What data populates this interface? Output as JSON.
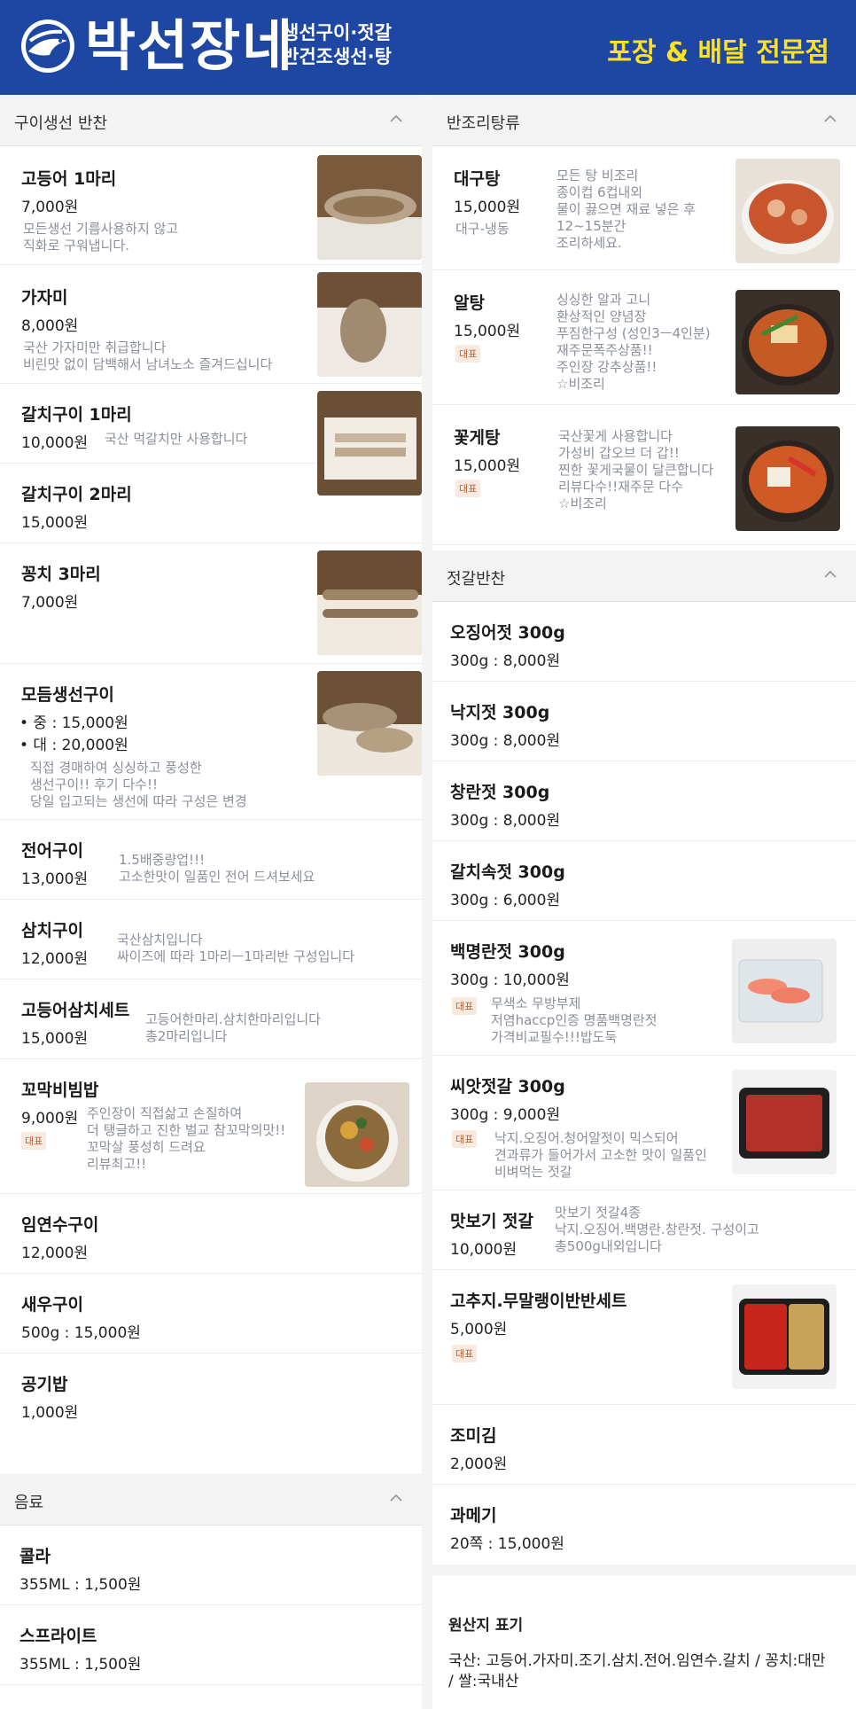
{
  "header": {
    "brand": "박선장네",
    "sub1": "생선구이·젓갈",
    "sub2": "반건조생선·탕",
    "slogan": "포장 & 배달 전문점"
  },
  "badge_label": "대표",
  "left": {
    "grilled": {
      "title": "구이생선 반찬",
      "items": [
        {
          "name": "고등어 1마리",
          "price": "7,000원",
          "desc1": "모든생선 기름사용하지  않고",
          "desc2": "직화로 구워냅니다."
        },
        {
          "name": "가자미",
          "price": "8,000원",
          "desc1": "국산  가자미만 취급합니다",
          "desc2": "비린맛 없이 담백해서 남녀노소 즐겨드십니다"
        },
        {
          "name": "갈치구이 1마리",
          "price": "10,000원",
          "desc1": "국산 먹갈치만  사용합니다"
        },
        {
          "name": "갈치구이 2마리",
          "price": "15,000원"
        },
        {
          "name": "꽁치 3마리",
          "price": "7,000원"
        },
        {
          "name": "모듬생선구이",
          "price1": "• 중 : 15,000원",
          "price2": "• 대 : 20,000원",
          "desc1": "직접 경매하여 싱싱하고 풍성한",
          "desc2": "생선구이!! 후기 다수!!",
          "desc3": "당일 입고되는 생선에 따라 구성은 변경"
        },
        {
          "name": "전어구이",
          "price": "13,000원",
          "desc1": "1.5배중량업!!!",
          "desc2": "고소한맛이 일품인 전어 드셔보세요"
        },
        {
          "name": "삼치구이",
          "price": "12,000원",
          "desc1": "국산삼치입니다",
          "desc2": "싸이즈에  따라 1마리ㅡ1마리반 구성입니다"
        },
        {
          "name": "고등어삼치세트",
          "price": "15,000원",
          "desc1": "고등어한마리.삼치한마리입니다",
          "desc2": "총2마리입니다"
        },
        {
          "name": "꼬막비빔밥",
          "price": "9,000원",
          "desc1": "주인장이 직접삶고  손질하여",
          "desc2": "더 탱글하고 진한 벌교 참꼬막의맛!!",
          "desc3": "꼬막살 풍성히 드려요",
          "desc4": "리뷰최고!!"
        },
        {
          "name": "임연수구이",
          "price": "12,000원"
        },
        {
          "name": "새우구이",
          "price": "500g : 15,000원"
        },
        {
          "name": "공기밥",
          "price": "1,000원"
        }
      ]
    },
    "drinks": {
      "title": "음료",
      "items": [
        {
          "name": "콜라",
          "price": "355ML : 1,500원"
        },
        {
          "name": "스프라이트",
          "price": "355ML : 1,500원"
        }
      ]
    }
  },
  "right": {
    "stew": {
      "title": "반조리탕류",
      "items": [
        {
          "name": "대구탕",
          "price": "15,000원",
          "note": "대구-냉동",
          "desc1": "모든 탕 비조리",
          "desc2": "종이컵 6컵내외",
          "desc3": "물이 끓으면 재료 넣은 후",
          "desc4": "12~15분간",
          "desc5": "조리하세요."
        },
        {
          "name": "알탕",
          "price": "15,000원",
          "desc1": "싱싱한 알과 고니",
          "desc2": "환상적인 양념장",
          "desc3": "푸짐한구성 (성인3ㅡ4인분)",
          "desc4": "재주문폭주상품!!",
          "desc5": "주인장 강추상품!!",
          "desc6": "☆비조리"
        },
        {
          "name": "꽃게탕",
          "price": "15,000원",
          "desc1": "국산꽃게  사용합니다",
          "desc2": "가성비 갑오브 더 갑!!",
          "desc3": "찐한 꽃게국물이 달큰합니다",
          "desc4": "리뷰다수!!재주문 다수",
          "desc5": "☆비조리"
        }
      ]
    },
    "jeotgal": {
      "title": "젓갈반찬",
      "items": [
        {
          "name": "오징어젓 300g",
          "price": "300g : 8,000원"
        },
        {
          "name": "낙지젓 300g",
          "price": "300g : 8,000원"
        },
        {
          "name": "창란젓 300g",
          "price": "300g : 8,000원"
        },
        {
          "name": "갈치속젓 300g",
          "price": "300g : 6,000원"
        },
        {
          "name": "백명란젓 300g",
          "price": "300g : 10,000원",
          "desc1": "무색소 무방부제",
          "desc2": "저염haccp인증 명품백명란젓",
          "desc3": "가격비교필수!!!밥도둑"
        },
        {
          "name": "씨앗젓갈 300g",
          "price": "300g : 9,000원",
          "desc1": "낙지.오징어.청어알젓이 믹스되어",
          "desc2": "견과류가 들어가서 고소한 맛이 일품인",
          "desc3": "비벼먹는 젓갈"
        },
        {
          "name": "맛보기 젓갈",
          "price": "10,000원",
          "desc1": "맛보기 젓갈4종",
          "desc2": "낙지.오징어.백명란.창란젓. 구성이고",
          "desc3": "총500g내외입니다"
        },
        {
          "name": "고추지.무말랭이반반세트",
          "price": "5,000원"
        },
        {
          "name": "조미김",
          "price": "2,000원"
        },
        {
          "name": "과메기",
          "price": "20쪽 : 15,000원"
        }
      ]
    },
    "origin": {
      "title": "원산지 표기",
      "line1": "국산: 고등어.가자미.조기.삼치.전어.임연수.갈치 / 꽁치:대만",
      "line2": "/ 쌀:국내산"
    }
  },
  "colors": {
    "header_bg": "#1e47a3",
    "slogan": "#ffe11f",
    "badge_bg": "#f8eadf",
    "badge_text": "#b0623b",
    "desc": "#8a8f99"
  }
}
